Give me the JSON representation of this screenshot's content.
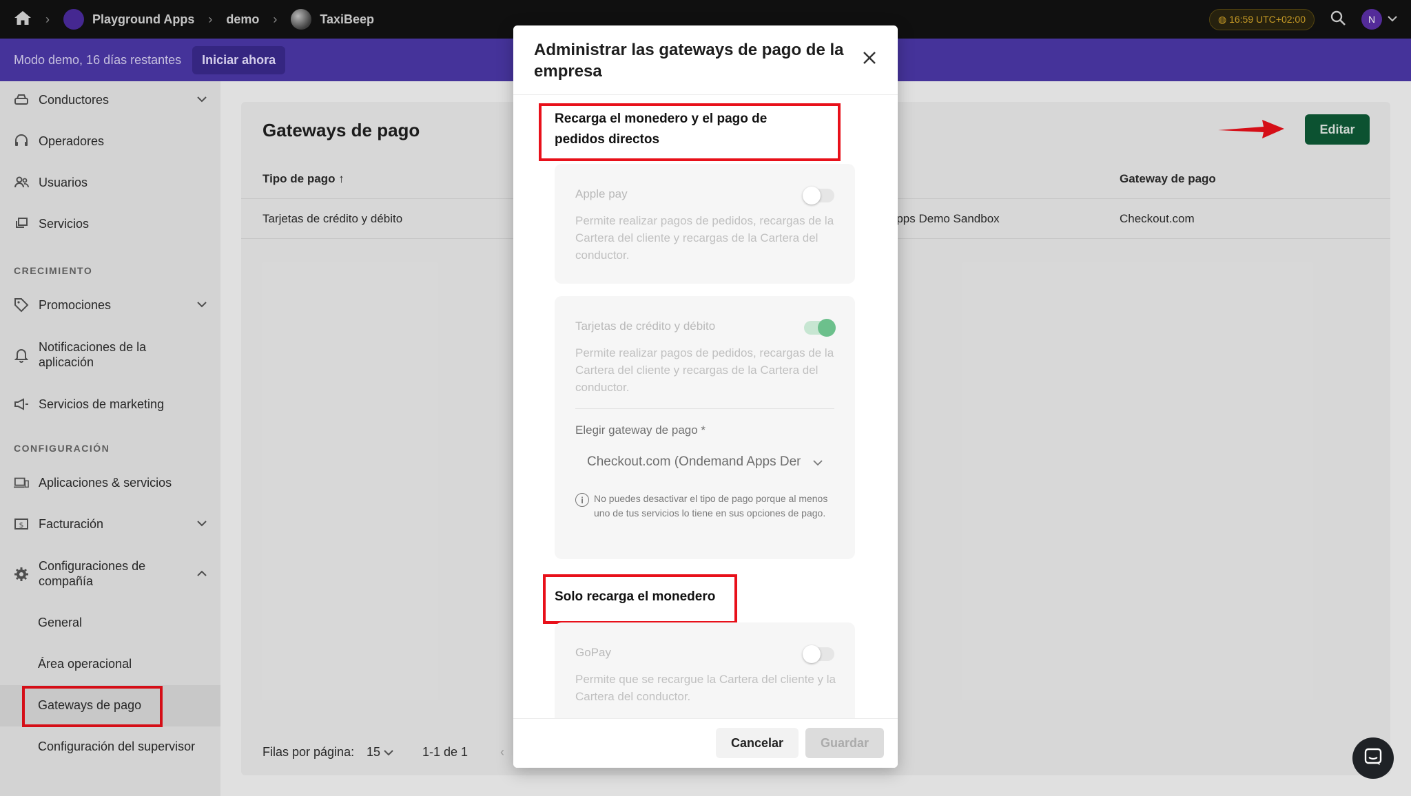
{
  "topbar": {
    "breadcrumb": [
      "Playground Apps",
      "demo",
      "TaxiBeep"
    ],
    "clock": "16:59 UTC+02:00",
    "avatar_initial": "N"
  },
  "demo_banner": {
    "text": "Modo demo, 16 días restantes",
    "button": "Iniciar ahora"
  },
  "sidebar": {
    "items": [
      {
        "label": "Conductores",
        "icon": "car-icon",
        "expandable": true
      },
      {
        "label": "Operadores",
        "icon": "headset-icon",
        "expandable": false
      },
      {
        "label": "Usuarios",
        "icon": "users-icon",
        "expandable": false
      },
      {
        "label": "Servicios",
        "icon": "services-icon",
        "expandable": false
      }
    ],
    "section_growth": "CRECIMIENTO",
    "growth_items": [
      {
        "label": "Promociones",
        "icon": "tag-icon",
        "expandable": true
      },
      {
        "label": "Notificaciones de la aplicación",
        "icon": "bell-icon",
        "expandable": false
      },
      {
        "label": "Servicios de marketing",
        "icon": "megaphone-icon",
        "expandable": false
      }
    ],
    "section_config": "CONFIGURACIÓN",
    "config_items": [
      {
        "label": "Aplicaciones & servicios",
        "icon": "devices-icon",
        "expandable": false
      },
      {
        "label": "Facturación",
        "icon": "billing-icon",
        "expandable": true
      },
      {
        "label": "Configuraciones de compañía",
        "icon": "gear-icon",
        "expandable": true
      }
    ],
    "sub_items": [
      "General",
      "Área operacional",
      "Gateways de pago",
      "Configuración del supervisor"
    ]
  },
  "main": {
    "title": "Gateways de pago",
    "edit_button": "Editar",
    "columns": [
      "Tipo de pago",
      "Gateway de pago"
    ],
    "rows": [
      {
        "type": "Tarjetas de crédito y débito",
        "account": "Apps Demo Sandbox",
        "gateway": "Checkout.com"
      }
    ],
    "rows_per_page_label": "Filas por página:",
    "rows_per_page": "15",
    "range": "1-1 de 1"
  },
  "modal": {
    "title": "Administrar las gateways de pago de la empresa",
    "group1_title": "Recarga el monedero y el pago de pedidos directos",
    "apple_pay": {
      "name": "Apple pay",
      "enabled": false,
      "description": "Permite realizar pagos de pedidos, recargas de la Cartera del cliente y recargas de la Cartera del conductor."
    },
    "cards": {
      "name": "Tarjetas de crédito y débito",
      "enabled": true,
      "description": "Permite realizar pagos de pedidos, recargas de la Cartera del cliente y recargas de la Cartera del conductor.",
      "select_label": "Elegir gateway de pago *",
      "select_value": "Checkout.com (Ondemand Apps Demo Sandbox)",
      "info": "No puedes desactivar el tipo de pago porque al menos uno de tus servicios lo tiene en sus opciones de pago."
    },
    "group2_title": "Solo recarga el monedero",
    "gopay": {
      "name": "GoPay",
      "enabled": false,
      "description": "Permite que se recargue la Cartera del cliente y la Cartera del conductor."
    },
    "cancel_button": "Cancelar",
    "save_button": "Guardar"
  },
  "colors": {
    "topbar": "#121212",
    "demo_banner": "#4b38a8",
    "edit_button": "#0e5a36",
    "toggle_on": "#6cc08c",
    "highlight": "#e8101a"
  }
}
